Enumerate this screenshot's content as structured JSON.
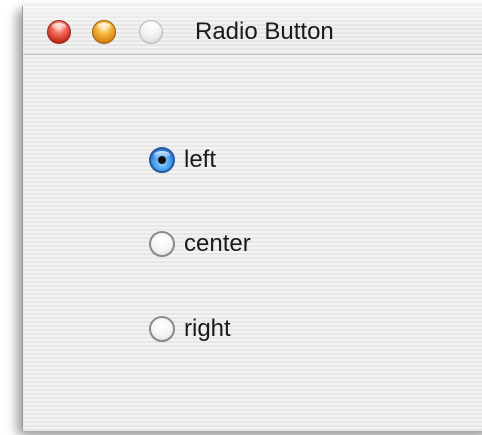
{
  "window": {
    "title": "Radio Button"
  },
  "radio_group": {
    "options": [
      {
        "label": "left",
        "selected": true
      },
      {
        "label": "center",
        "selected": false
      },
      {
        "label": "right",
        "selected": false
      }
    ]
  },
  "colors": {
    "close_button": "#e0483a",
    "minimize_button": "#f0a52a",
    "zoom_button_inactive": "#e2e2e2",
    "selected_radio": "#3b8fe6"
  },
  "icons": {
    "close": "close-button-icon",
    "minimize": "minimize-button-icon",
    "zoom": "zoom-button-icon",
    "radio_selected": "radio-selected-icon",
    "radio_unselected": "radio-unselected-icon"
  }
}
